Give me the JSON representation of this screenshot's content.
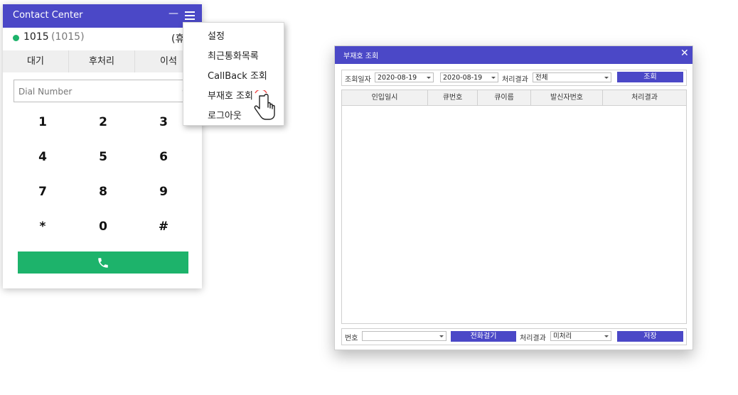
{
  "contact_center": {
    "title": "Contact Center",
    "minimize": "—",
    "extension": "1015",
    "extension_paren": "(1015)",
    "status_right": "(휴",
    "status_color": "#1db36b",
    "tabs": [
      {
        "label": "대기"
      },
      {
        "label": "후처리"
      },
      {
        "label": "이석"
      }
    ],
    "dial_placeholder": "Dial Number",
    "keypad": [
      "1",
      "2",
      "3",
      "4",
      "5",
      "6",
      "7",
      "8",
      "9",
      "*",
      "0",
      "#"
    ],
    "call_icon": "phone-icon",
    "accent": "#4b48c7",
    "call_color": "#1db36b"
  },
  "menu": {
    "items": [
      {
        "label": "설정"
      },
      {
        "label": "최근통화목록"
      },
      {
        "label": "CallBack 조회"
      },
      {
        "label": "부재호 조회"
      },
      {
        "label": "로그아웃"
      }
    ]
  },
  "dialog": {
    "title": "부재호 조회",
    "close": "✕",
    "filter": {
      "date_label": "조회일자",
      "date_from": "2020-08-19",
      "date_to": "2020-08-19",
      "result_label": "처리결과",
      "result_value": "전체",
      "search_button": "조회"
    },
    "columns": [
      "인입일시",
      "큐번호",
      "큐이름",
      "발신자번호",
      "처리결과"
    ],
    "rows": [],
    "footer": {
      "number_label": "번호",
      "number_value": "",
      "call_button": "전화걸기",
      "result_label": "처리결과",
      "result_value": "미처리",
      "save_button": "저장"
    }
  }
}
